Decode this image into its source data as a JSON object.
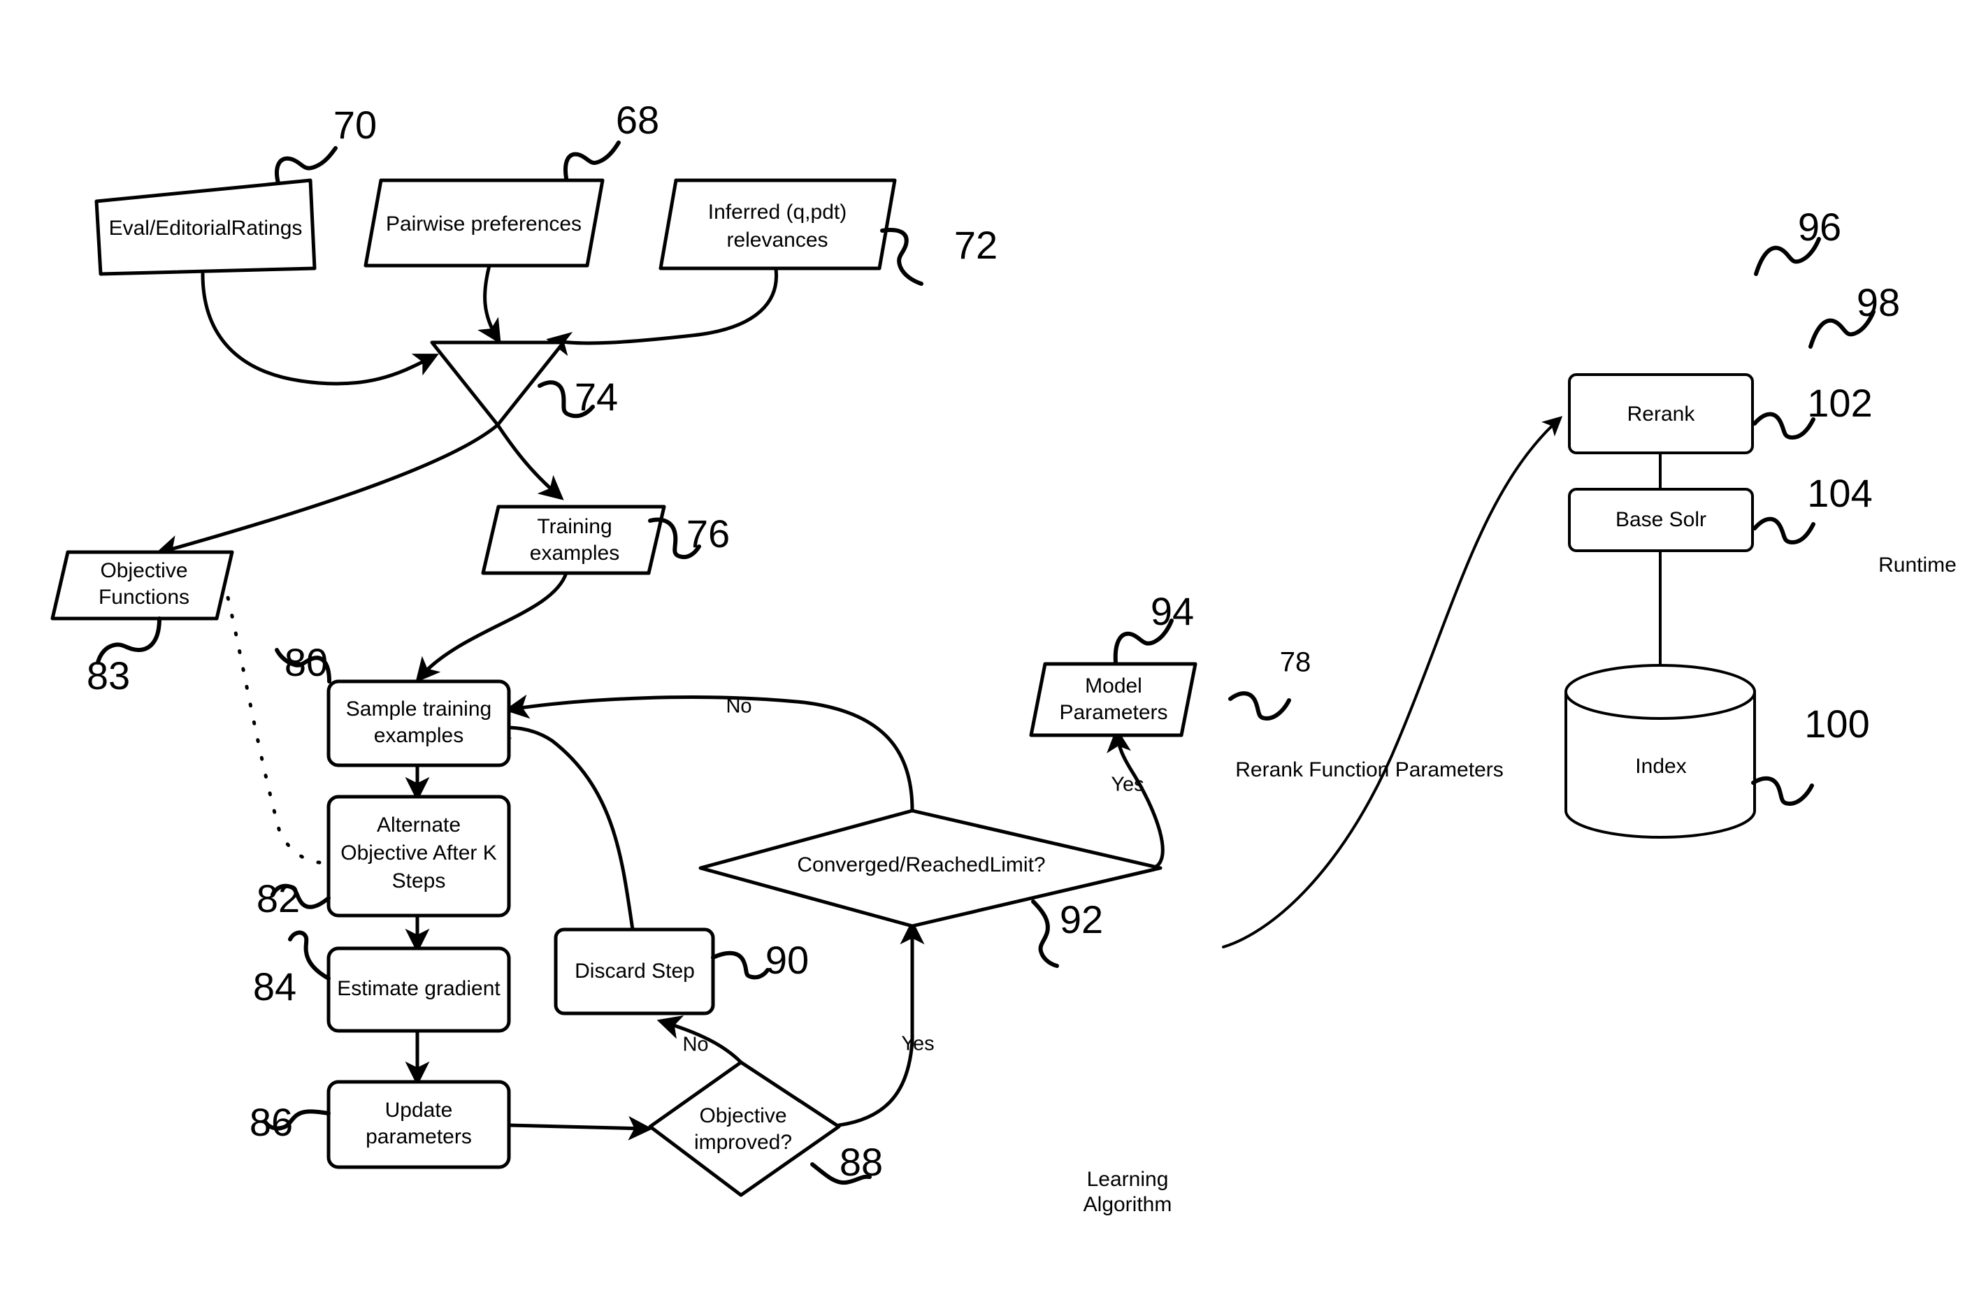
{
  "diagram": {
    "title": "Learning to Rank system flow diagram",
    "nodes": [
      {
        "id": "eval_ratings",
        "label": "Eval/EditorialRatings",
        "ref": "70",
        "shape": "tilted-rect"
      },
      {
        "id": "pairwise",
        "label": "Pairwise preferences",
        "ref": "68",
        "shape": "parallelogram"
      },
      {
        "id": "inferred",
        "label": "Inferred (q,pdt)\nrelevances",
        "ref": "72",
        "shape": "parallelogram"
      },
      {
        "id": "merge",
        "label": "",
        "ref": "74",
        "shape": "triangle"
      },
      {
        "id": "training",
        "label": "Training\nexamples",
        "ref": "76",
        "shape": "parallelogram"
      },
      {
        "id": "objective_fn",
        "label": "Objective\nFunctions",
        "ref": "83",
        "shape": "parallelogram"
      },
      {
        "id": "sample",
        "label": "Sample training\nexamples",
        "ref": "80",
        "shape": "rounded-rect"
      },
      {
        "id": "alternate",
        "label": "Alternate\nObjective After K\nSteps",
        "ref": "82",
        "shape": "rounded-rect"
      },
      {
        "id": "estimate",
        "label": "Estimate gradient",
        "ref": "84",
        "shape": "rounded-rect"
      },
      {
        "id": "update",
        "label": "Update\nparameters",
        "ref": "86",
        "shape": "rounded-rect"
      },
      {
        "id": "obj_improved",
        "label": "Objective\nimproved?",
        "ref": "88",
        "shape": "diamond"
      },
      {
        "id": "discard",
        "label": "Discard Step",
        "ref": "90",
        "shape": "rect"
      },
      {
        "id": "converged",
        "label": "Converged/ReachedLimit?",
        "ref": "92",
        "shape": "diamond"
      },
      {
        "id": "model_params",
        "label": "Model\nParameters",
        "ref": "94",
        "shape": "parallelogram"
      },
      {
        "id": "rerank",
        "label": "Rerank",
        "ref": "102",
        "shape": "rounded-rect"
      },
      {
        "id": "base_solr",
        "label": "Base Solr",
        "ref": "104",
        "shape": "rounded-rect"
      },
      {
        "id": "index",
        "label": "Index",
        "ref": "100",
        "shape": "cylinder"
      }
    ],
    "node_labels": {
      "eval_ratings": "Eval/EditorialRatings",
      "pairwise": "Pairwise preferences",
      "inferred_l1": "Inferred (q,pdt)",
      "inferred_l2": "relevances",
      "training_l1": "Training",
      "training_l2": "examples",
      "objective_l1": "Objective",
      "objective_l2": "Functions",
      "sample_l1": "Sample training",
      "sample_l2": "examples",
      "alternate_l1": "Alternate",
      "alternate_l2": "Objective After K",
      "alternate_l3": "Steps",
      "estimate": "Estimate gradient",
      "update_l1": "Update",
      "update_l2": "parameters",
      "obj_improved_l1": "Objective",
      "obj_improved_l2": "improved?",
      "discard": "Discard Step",
      "converged": "Converged/ReachedLimit?",
      "model_params_l1": "Model",
      "model_params_l2": "Parameters",
      "rerank": "Rerank",
      "base_solr": "Base Solr",
      "index": "Index"
    },
    "reference_numerals": {
      "eval_ratings": "70",
      "pairwise": "68",
      "inferred": "72",
      "merge": "74",
      "training": "76",
      "objective_fn": "83",
      "sample": "80",
      "alternate": "82",
      "estimate": "84",
      "update": "86",
      "obj_improved": "88",
      "discard": "90",
      "converged": "92",
      "model_params": "94",
      "rerank_group": "96",
      "runtime_group": "98",
      "rerank": "102",
      "base_solr": "104",
      "index": "100",
      "rerank_params": "78"
    },
    "edge_labels": {
      "converged_no": "No",
      "converged_yes": "Yes",
      "improved_no": "No",
      "improved_yes": "Yes"
    },
    "annotations": {
      "rerank_function_parameters": "Rerank Function Parameters",
      "learning_algorithm_l1": "Learning",
      "learning_algorithm_l2": "Algorithm",
      "runtime": "Runtime"
    },
    "colors": {
      "stroke": "#000000",
      "fill": "#ffffff",
      "background": "#ffffff"
    }
  }
}
